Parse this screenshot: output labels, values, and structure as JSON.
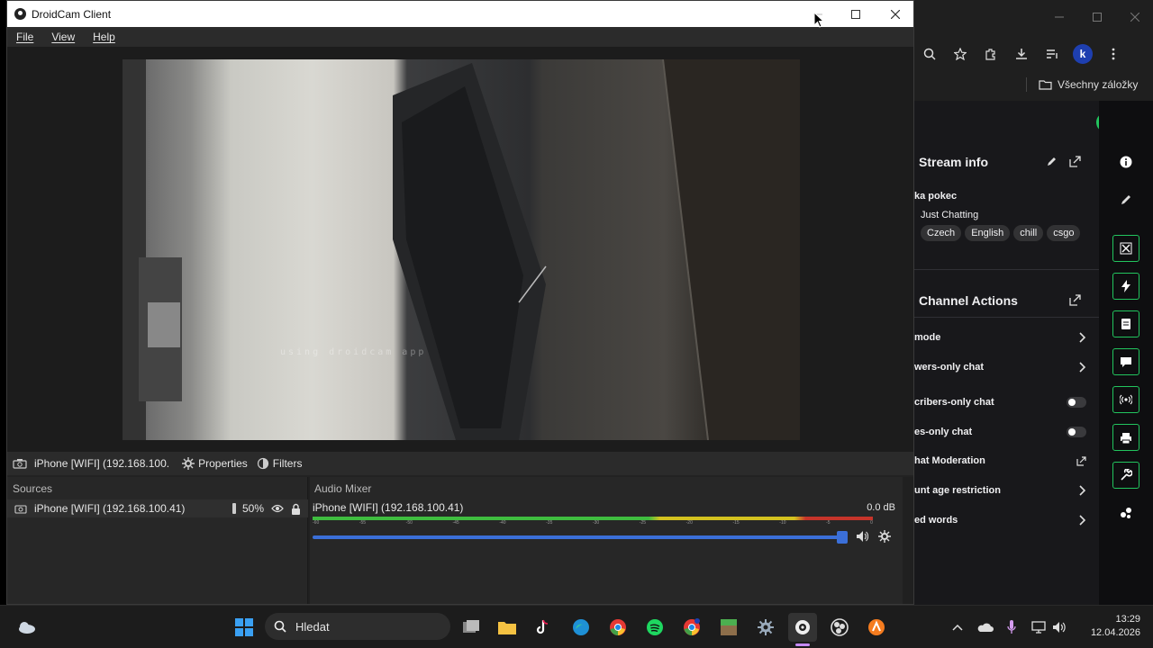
{
  "browser": {
    "bookmarks_label": "Všechny záložky",
    "profile_initial": "k",
    "stream_info": {
      "title": "Stream info",
      "stream_title": "ka pokec",
      "category": "Just Chatting",
      "tags": [
        "Czech",
        "English",
        "chill",
        "csgo"
      ]
    },
    "channel_actions": {
      "title": "Channel Actions",
      "rows": [
        {
          "label": "mode",
          "control": "chevron"
        },
        {
          "label": "wers-only chat",
          "control": "chevron"
        },
        {
          "label": "cribers-only chat",
          "control": "toggle"
        },
        {
          "label": "es-only chat",
          "control": "toggle"
        },
        {
          "label": "hat Moderation",
          "control": "external"
        },
        {
          "label": "unt age restriction",
          "control": "chevron"
        },
        {
          "label": "ed words",
          "control": "chevron"
        }
      ]
    }
  },
  "droidcam": {
    "title": "DroidCam Client",
    "menu": [
      "File",
      "View",
      "Help"
    ],
    "watermark": "using droidcam app",
    "source_bar": {
      "source": "iPhone [WIFI] (192.168.100.",
      "properties": "Properties",
      "filters": "Filters"
    },
    "sources": {
      "title": "Sources",
      "item": "iPhone [WIFI] (192.168.100.41)",
      "opacity": "50%"
    },
    "mixer": {
      "title": "Audio Mixer",
      "channel": "iPhone [WIFI] (192.168.100.41)",
      "db": "0.0 dB",
      "ticks": [
        "-60",
        "-55",
        "-50",
        "-45",
        "-40",
        "-35",
        "-30",
        "-25",
        "-20",
        "-15",
        "-10",
        "-5",
        "0"
      ],
      "volume_fraction": 1.0
    }
  },
  "taskbar": {
    "search_placeholder": "Hledat",
    "time": "13:29",
    "date": "12.04.2026"
  }
}
